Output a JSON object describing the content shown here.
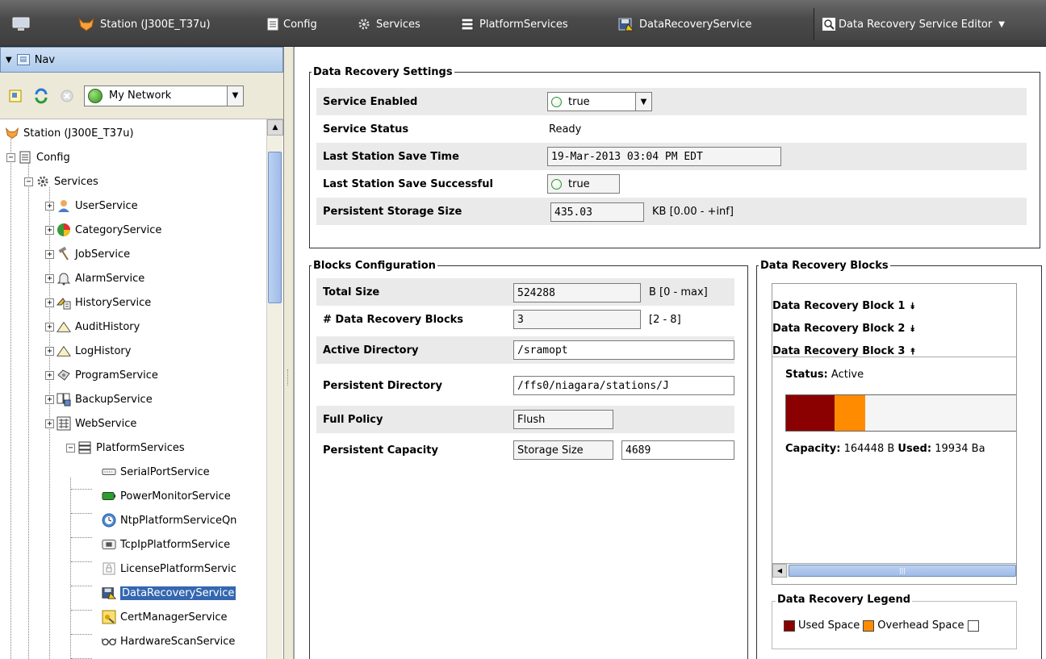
{
  "breadcrumbs": [
    {
      "label": "Station (J300E_T37u)",
      "icon": "station-icon"
    },
    {
      "label": "Config",
      "icon": "config-icon"
    },
    {
      "label": "Services",
      "icon": "services-icon"
    },
    {
      "label": "PlatformServices",
      "icon": "platform-services-icon"
    },
    {
      "label": "DataRecoveryService",
      "icon": "data-recovery-icon"
    }
  ],
  "editor": {
    "label": "Data Recovery Service Editor"
  },
  "nav": {
    "title": "Nav",
    "network": "My Network",
    "tree": [
      {
        "label": "Station (J300E_T37u)",
        "icon": "station-icon"
      },
      {
        "label": "Config",
        "icon": "config-icon"
      },
      {
        "label": "Services",
        "icon": "services-icon"
      },
      {
        "label": "UserService",
        "icon": "user-icon"
      },
      {
        "label": "CategoryService",
        "icon": "category-icon"
      },
      {
        "label": "JobService",
        "icon": "hammer-icon"
      },
      {
        "label": "AlarmService",
        "icon": "bell-icon"
      },
      {
        "label": "HistoryService",
        "icon": "history-icon"
      },
      {
        "label": "AuditHistory",
        "icon": "triangle-icon"
      },
      {
        "label": "LogHistory",
        "icon": "triangle-icon"
      },
      {
        "label": "ProgramService",
        "icon": "program-icon"
      },
      {
        "label": "BackupService",
        "icon": "backup-icon"
      },
      {
        "label": "WebService",
        "icon": "web-icon"
      },
      {
        "label": "PlatformServices",
        "icon": "platform-services-icon"
      },
      {
        "label": "SerialPortService",
        "icon": "serial-port-icon"
      },
      {
        "label": "PowerMonitorService",
        "icon": "battery-icon"
      },
      {
        "label": "NtpPlatformServiceQn",
        "icon": "clock-icon"
      },
      {
        "label": "TcpIpPlatformService",
        "icon": "network-card-icon"
      },
      {
        "label": "LicensePlatformServic",
        "icon": "license-icon"
      },
      {
        "label": "DataRecoveryService",
        "icon": "data-recovery-icon"
      },
      {
        "label": "CertManagerService",
        "icon": "certificate-icon"
      },
      {
        "label": "HardwareScanService",
        "icon": "glasses-icon"
      }
    ]
  },
  "settings": {
    "title": "Data Recovery Settings",
    "service_enabled_label": "Service Enabled",
    "service_enabled_value": "true",
    "service_status_label": "Service Status",
    "service_status_value": "Ready",
    "last_save_time_label": "Last Station Save Time",
    "last_save_time_value": "19-Mar-2013 03:04 PM EDT",
    "last_save_success_label": "Last Station Save Successful",
    "last_save_success_value": "true",
    "storage_size_label": "Persistent Storage Size",
    "storage_size_value": "435.03",
    "storage_size_unit": "KB [0.00 - +inf]"
  },
  "blocks_config": {
    "title": "Blocks Configuration",
    "total_size_label": "Total Size",
    "total_size_value": "524288",
    "total_size_unit": "B [0 - max]",
    "num_blocks_label": "# Data Recovery Blocks",
    "num_blocks_value": "3",
    "num_blocks_range": "[2 - 8]",
    "active_dir_label": "Active Directory",
    "active_dir_value": "/sramopt",
    "persistent_dir_label": "Persistent Directory",
    "persistent_dir_value": "/ffs0/niagara/stations/J",
    "full_policy_label": "Full Policy",
    "full_policy_value": "Flush",
    "capacity_label": "Persistent Capacity",
    "capacity_mode": "Storage Size",
    "capacity_value": "4689"
  },
  "blocks": {
    "title": "Data Recovery Blocks",
    "items": [
      {
        "label": "Data Recovery Block 1",
        "icon": "expand-chevron-icon"
      },
      {
        "label": "Data Recovery Block 2",
        "icon": "expand-chevron-icon"
      },
      {
        "label": "Data Recovery Block 3",
        "icon": "collapse-chevron-icon"
      }
    ],
    "status_label": "Status:",
    "status_value": "Active",
    "capacity_label": "Capacity:",
    "capacity_value": "164448 B",
    "used_label": "Used:",
    "used_value": "19934 Ba",
    "used_fraction": 0.21,
    "overhead_fraction": 0.13
  },
  "legend": {
    "title": "Data Recovery Legend",
    "used": "Used Space",
    "overhead": "Overhead Space",
    "colors": {
      "used": "#8b0000",
      "overhead": "#ff8c00"
    }
  }
}
